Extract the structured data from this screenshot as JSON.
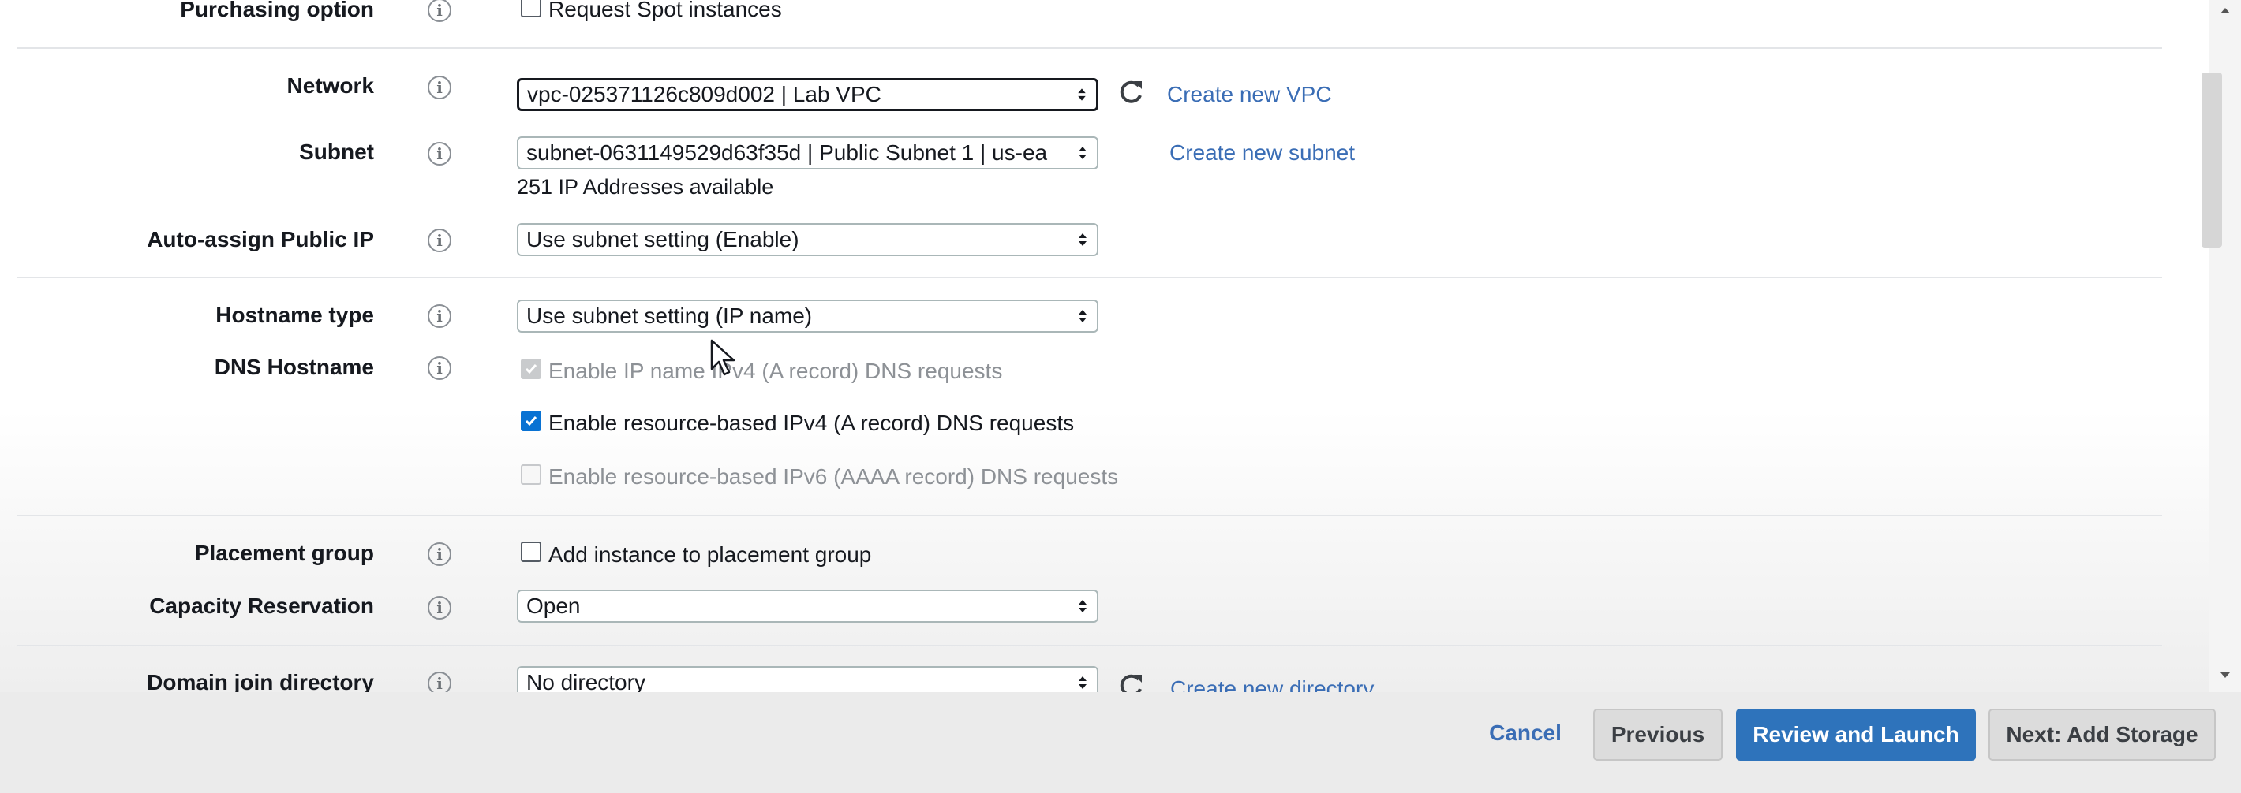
{
  "form": {
    "purchasing_option": {
      "label": "Purchasing option",
      "checkbox_label": "Request Spot instances",
      "checked": false
    },
    "network": {
      "label": "Network",
      "value": "vpc-025371126c809d002 | Lab VPC",
      "create_link": "Create new VPC"
    },
    "subnet": {
      "label": "Subnet",
      "value": "subnet-0631149529d63f35d | Public Subnet 1 | us-ea",
      "helper": "251 IP Addresses available",
      "create_link": "Create new subnet"
    },
    "auto_assign_ip": {
      "label": "Auto-assign Public IP",
      "value": "Use subnet setting (Enable)"
    },
    "hostname_type": {
      "label": "Hostname type",
      "value": "Use subnet setting (IP name)"
    },
    "dns_hostname": {
      "label": "DNS Hostname",
      "options": [
        {
          "label": "Enable IP name IPv4 (A record) DNS requests",
          "checked": true,
          "disabled": true
        },
        {
          "label": "Enable resource-based IPv4 (A record) DNS requests",
          "checked": true,
          "disabled": false
        },
        {
          "label": "Enable resource-based IPv6 (AAAA record) DNS requests",
          "checked": false,
          "disabled": true
        }
      ]
    },
    "placement_group": {
      "label": "Placement group",
      "checkbox_label": "Add instance to placement group",
      "checked": false
    },
    "capacity_reservation": {
      "label": "Capacity Reservation",
      "value": "Open"
    },
    "domain_join": {
      "label": "Domain join directory",
      "value": "No directory",
      "create_link": "Create new directory"
    }
  },
  "info_glyph": "i",
  "footer": {
    "cancel": "Cancel",
    "previous": "Previous",
    "review_launch": "Review and Launch",
    "next": "Next: Add Storage"
  },
  "colors": {
    "primary_button": "#2e73bb",
    "link": "#3a6db5",
    "checkbox_checked": "#0972d3"
  }
}
